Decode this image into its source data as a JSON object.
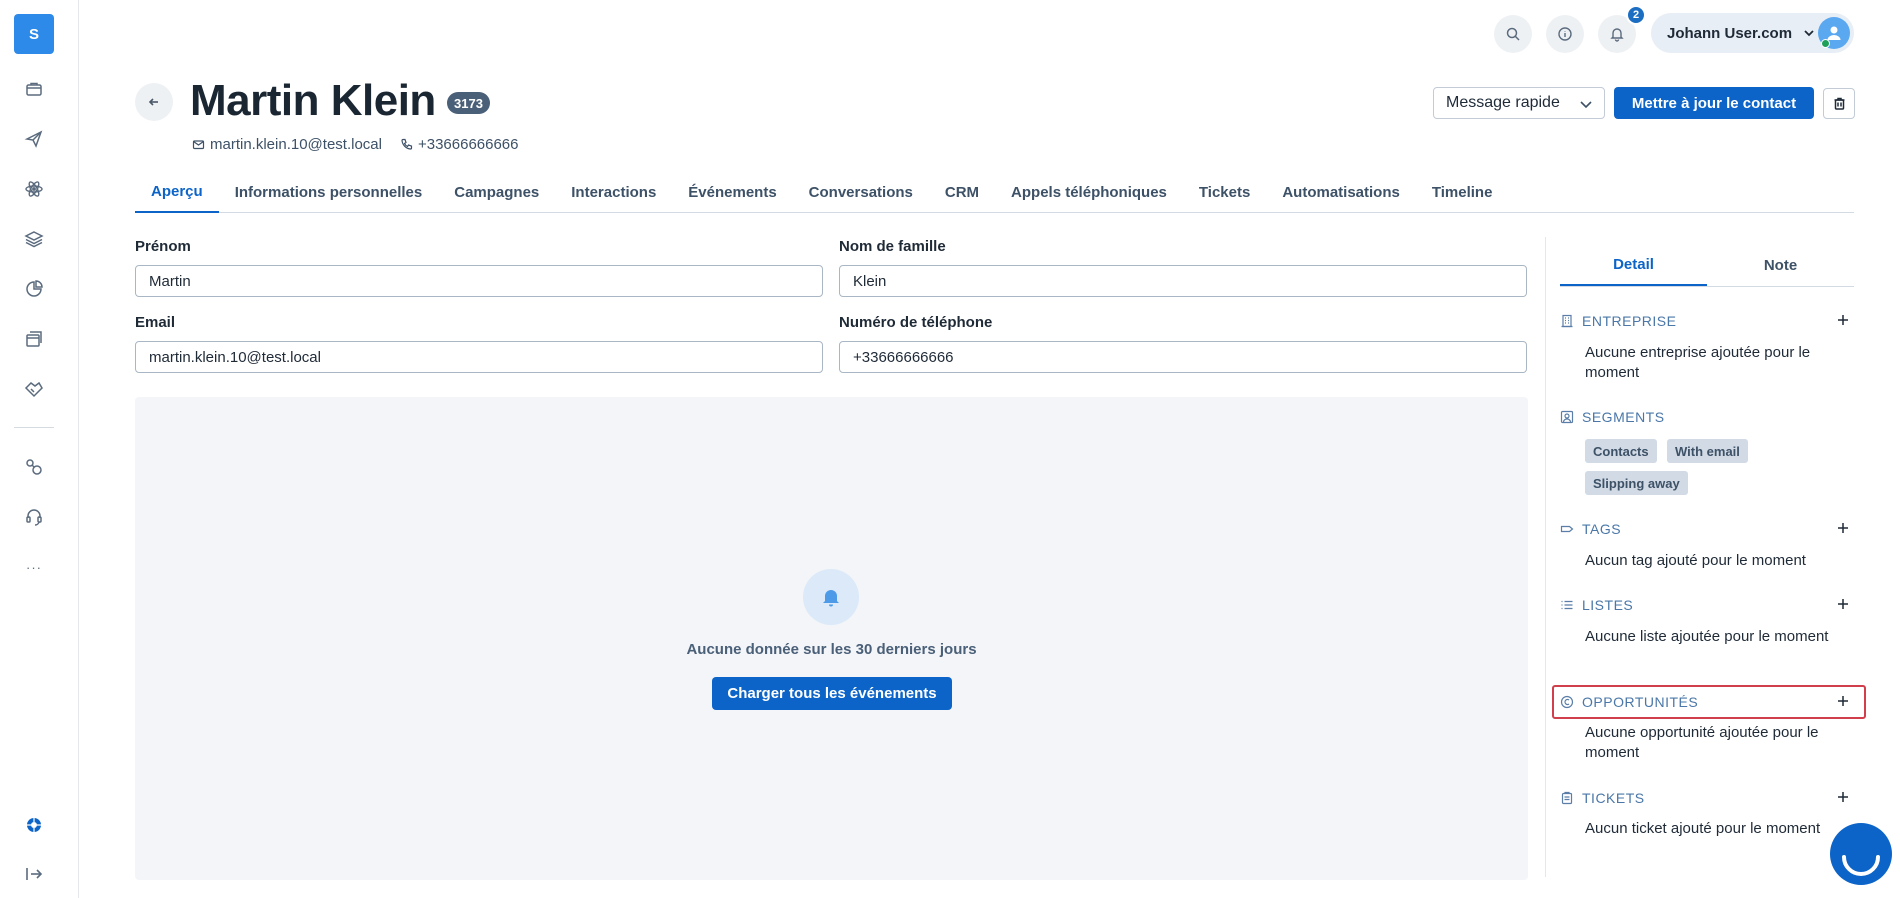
{
  "sidebar": {
    "logo_text": "S",
    "items": [
      {
        "icon": "briefcase-icon"
      },
      {
        "icon": "paper-plane-icon"
      },
      {
        "icon": "atom-icon"
      },
      {
        "icon": "layers-icon"
      },
      {
        "icon": "pie-chart-icon"
      },
      {
        "icon": "window-stack-icon"
      },
      {
        "icon": "handshake-icon"
      },
      {
        "icon": "integrations-icon"
      },
      {
        "icon": "headset-icon"
      }
    ],
    "more_label": "···"
  },
  "topbar": {
    "notification_count": "2",
    "user_name": "Johann User.com"
  },
  "header": {
    "title": "Martin Klein",
    "id_badge": "3173",
    "email": "martin.klein.10@test.local",
    "phone": "+33666666666",
    "quick_message_label": "Message rapide",
    "update_button_label": "Mettre à jour le contact"
  },
  "tabs": [
    {
      "label": "Aperçu",
      "active": true
    },
    {
      "label": "Informations personnelles"
    },
    {
      "label": "Campagnes"
    },
    {
      "label": "Interactions"
    },
    {
      "label": "Événements"
    },
    {
      "label": "Conversations"
    },
    {
      "label": "CRM"
    },
    {
      "label": "Appels téléphoniques"
    },
    {
      "label": "Tickets"
    },
    {
      "label": "Automatisations"
    },
    {
      "label": "Timeline"
    }
  ],
  "form": {
    "first_name_label": "Prénom",
    "first_name_value": "Martin",
    "last_name_label": "Nom de famille",
    "last_name_value": "Klein",
    "email_label": "Email",
    "email_value": "martin.klein.10@test.local",
    "phone_label": "Numéro de téléphone",
    "phone_value": "+33666666666"
  },
  "events": {
    "empty_text": "Aucune donnée sur les 30 derniers jours",
    "load_button_label": "Charger tous les événements"
  },
  "right_panel": {
    "tabs": [
      {
        "label": "Detail",
        "active": true
      },
      {
        "label": "Note"
      }
    ],
    "entreprise": {
      "title": "ENTREPRISE",
      "text": "Aucune entreprise ajoutée pour le moment"
    },
    "segments": {
      "title": "SEGMENTS",
      "chips": [
        "Contacts",
        "With email",
        "Slipping away"
      ]
    },
    "tags": {
      "title": "TAGS",
      "text": "Aucun tag ajouté pour le moment"
    },
    "listes": {
      "title": "LISTES",
      "text": "Aucune liste ajoutée pour le moment"
    },
    "opportunites": {
      "title": "OPPORTUNITÉS",
      "text": "Aucune opportunité ajoutée pour le moment"
    },
    "tickets": {
      "title": "TICKETS",
      "text": "Aucun ticket ajouté pour le moment"
    }
  },
  "colors": {
    "primary": "#0c64c8",
    "logo_bg": "#2d8ae8",
    "highlight": "#d03f4b",
    "section_title": "#4a77a8"
  }
}
